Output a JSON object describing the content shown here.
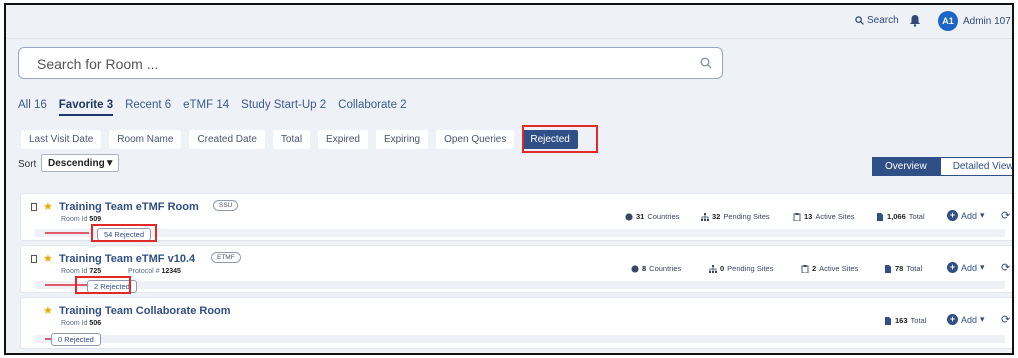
{
  "topbar": {
    "search_label": "Search",
    "avatar_initials": "A1",
    "user_name": "Admin 107 ▾"
  },
  "search": {
    "placeholder": "Search for Room ..."
  },
  "tabs": [
    {
      "label": "All 16"
    },
    {
      "label": "Favorite 3",
      "active": true
    },
    {
      "label": "Recent 6"
    },
    {
      "label": "eTMF 14"
    },
    {
      "label": "Study Start-Up 2"
    },
    {
      "label": "Collaborate 2"
    }
  ],
  "filters": [
    {
      "label": "Last Visit Date"
    },
    {
      "label": "Room Name"
    },
    {
      "label": "Created Date"
    },
    {
      "label": "Total"
    },
    {
      "label": "Expired"
    },
    {
      "label": "Expiring"
    },
    {
      "label": "Open Queries"
    },
    {
      "label": "Rejected",
      "selected": true
    }
  ],
  "sort": {
    "label": "Sort",
    "value": "Descending"
  },
  "view": {
    "overview": "Overview",
    "detailed": "Detailed View"
  },
  "rooms": [
    {
      "title": "Training Team eTMF Room",
      "badge": "SSU",
      "room_id_label": "Room Id",
      "room_id": "509",
      "rejected": "54 Rejected",
      "countries": "31",
      "countries_label": "Countries",
      "pending_sites": "32",
      "pending_label": "Pending Sites",
      "active_sites": "13",
      "active_label": "Active Sites",
      "total": "1,066",
      "total_label": "Total",
      "add_label": "Add"
    },
    {
      "title": "Training Team eTMF v10.4",
      "badge": "ETMF",
      "room_id_label": "Room Id",
      "room_id": "725",
      "protocol_label": "Protocol #",
      "protocol": "12345",
      "rejected": "2 Rejected",
      "countries": "8",
      "countries_label": "Countries",
      "pending_sites": "0",
      "pending_label": "Pending Sites",
      "active_sites": "2",
      "active_label": "Active Sites",
      "total": "78",
      "total_label": "Total",
      "add_label": "Add"
    },
    {
      "title": "Training Team Collaborate Room",
      "room_id_label": "Room Id",
      "room_id": "506",
      "rejected": "0 Rejected",
      "total": "163",
      "total_label": "Total",
      "add_label": "Add"
    }
  ]
}
